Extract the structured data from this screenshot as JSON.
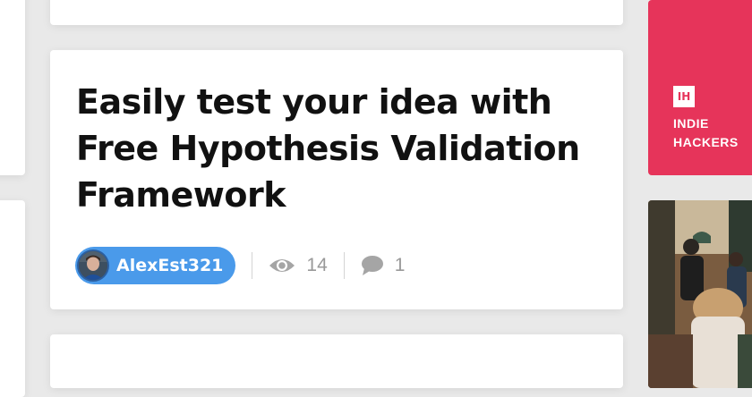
{
  "post": {
    "title": "Easily test your idea with Free Hypothesis Validation Framework",
    "author": "AlexEst321",
    "views": "14",
    "comments": "1"
  },
  "sidebar": {
    "ih_logo": "IH",
    "ih_name": "INDIE HACKERS"
  },
  "colors": {
    "accent_pink": "#e6345a",
    "author_pill": "#4a9aea",
    "meta_gray": "#999999"
  },
  "icons": {
    "views": "eye-icon",
    "comments": "comment-icon"
  }
}
